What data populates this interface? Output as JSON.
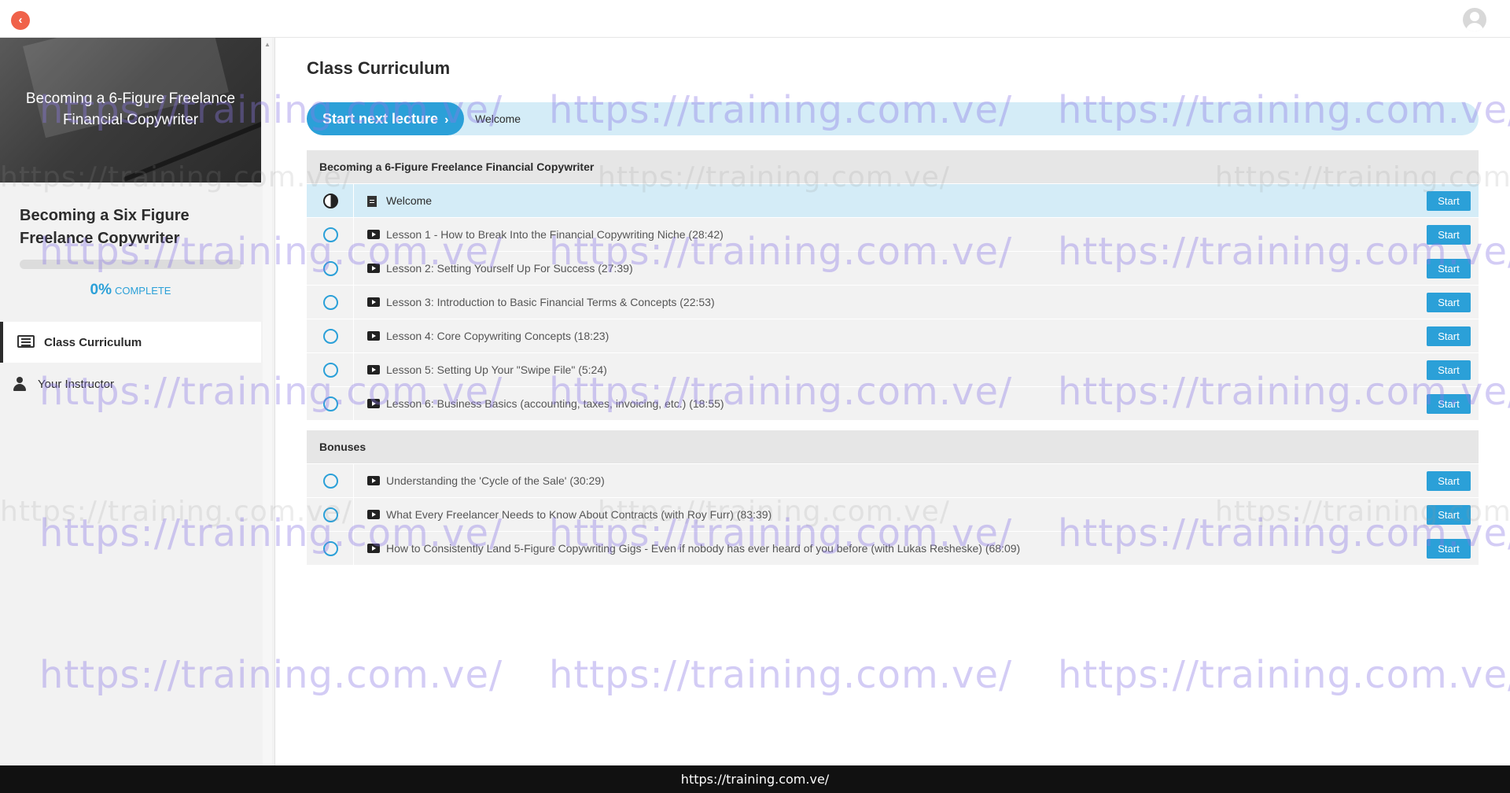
{
  "topbar": {
    "back_icon": "chevron-left-icon",
    "avatar_icon": "user-avatar-icon"
  },
  "sidebar": {
    "image_title": "Becoming a 6-Figure Freelance Financial Copywriter",
    "course_title": "Becoming a Six Figure Freelance Copywriter",
    "progress": {
      "value": 0,
      "percent_label": "0%",
      "complete_label": "COMPLETE"
    },
    "nav": [
      {
        "label": "Class Curriculum",
        "icon": "list-icon",
        "active": true
      },
      {
        "label": "Your Instructor",
        "icon": "user-icon",
        "active": false
      }
    ]
  },
  "main": {
    "title": "Class Curriculum",
    "next_button": "Start next lecture",
    "next_lecture": "Welcome",
    "sections": [
      {
        "title": "Becoming a 6-Figure Freelance Financial Copywriter",
        "lectures": [
          {
            "title": "Welcome",
            "type": "document",
            "status": "in-progress",
            "button": "Start"
          },
          {
            "title": "Lesson 1 - How to Break Into the Financial Copywriting Niche (28:42)",
            "type": "video",
            "status": "not-started",
            "button": "Start"
          },
          {
            "title": "Lesson 2: Setting Yourself Up For Success (27:39)",
            "type": "video",
            "status": "not-started",
            "button": "Start"
          },
          {
            "title": "Lesson 3: Introduction to Basic Financial Terms & Concepts (22:53)",
            "type": "video",
            "status": "not-started",
            "button": "Start"
          },
          {
            "title": "Lesson 4: Core Copywriting Concepts (18:23)",
            "type": "video",
            "status": "not-started",
            "button": "Start"
          },
          {
            "title": "Lesson 5: Setting Up Your \"Swipe File\" (5:24)",
            "type": "video",
            "status": "not-started",
            "button": "Start"
          },
          {
            "title": "Lesson 6: Business Basics (accounting, taxes, invoicing, etc.) (18:55)",
            "type": "video",
            "status": "not-started",
            "button": "Start"
          }
        ]
      },
      {
        "title": "Bonuses",
        "lectures": [
          {
            "title": "Understanding the 'Cycle of the Sale' (30:29)",
            "type": "video",
            "status": "not-started",
            "button": "Start"
          },
          {
            "title": "What Every Freelancer Needs to Know About Contracts (with Roy Furr) (83:39)",
            "type": "video",
            "status": "not-started",
            "button": "Start"
          },
          {
            "title": "How to Consistently Land 5-Figure Copywriting Gigs - Even if nobody has ever heard of you before (with Lukas Resheske) (68:09)",
            "type": "video",
            "status": "not-started",
            "button": "Start"
          }
        ]
      }
    ]
  },
  "watermark": "https://training.com.ve/",
  "footer": "https://training.com.ve/",
  "colors": {
    "accent": "#2ba0d8",
    "highlight": "#d4ecf7",
    "back_button": "#f0624a",
    "footer_bg": "#111111"
  }
}
